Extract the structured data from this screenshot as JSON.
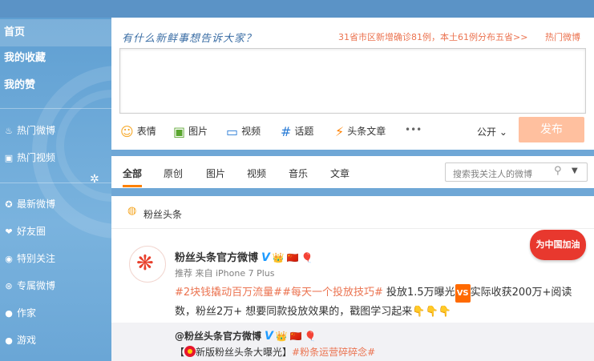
{
  "sidebar": {
    "main": [
      {
        "label": "首页"
      },
      {
        "label": "我的收藏"
      },
      {
        "label": "我的赞"
      }
    ],
    "groups": [
      {
        "label": "热门微博",
        "icon": "flame-icon"
      },
      {
        "label": "热门视频",
        "icon": "video-icon"
      },
      {
        "label": "最新微博",
        "icon": "star-icon"
      },
      {
        "label": "好友圈",
        "icon": "heart-icon"
      },
      {
        "label": "特别关注",
        "icon": "eye-icon"
      },
      {
        "label": "专属微博",
        "icon": "tag-icon"
      },
      {
        "label": "作家",
        "icon": "dot-icon"
      },
      {
        "label": "游戏",
        "icon": "dot-icon"
      }
    ]
  },
  "composer": {
    "prompt": "有什么新鲜事想告诉大家？",
    "trend": "31省市区新增确诊81例，本土61例分布五省>>",
    "trend_right": "热门微博",
    "tools": [
      {
        "label": "表情",
        "icon": "smile-icon",
        "glyph": "☺"
      },
      {
        "label": "图片",
        "icon": "image-icon",
        "glyph": "▣"
      },
      {
        "label": "视频",
        "icon": "video-icon",
        "glyph": "▭"
      },
      {
        "label": "话题",
        "icon": "hash-icon",
        "glyph": "#"
      },
      {
        "label": "头条文章",
        "icon": "bolt-icon",
        "glyph": "⚡"
      }
    ],
    "more": "•••",
    "visibility": "公开",
    "publish": "发布"
  },
  "tabs": {
    "items": [
      "全部",
      "原创",
      "图片",
      "视频",
      "音乐",
      "文章"
    ],
    "search_placeholder": "搜索我关注人的微博"
  },
  "feed": {
    "header": "粉丝头条",
    "post": {
      "author": "粉丝头条官方微博",
      "source": "推荐 来自 iPhone 7 Plus",
      "tag1": "#2块钱撬动百万流量#",
      "tag2": "#每天一个投放技巧#",
      "text1": "投放1.5万曝光",
      "vs": "VS",
      "text2": "实际收获200万+阅读数，粉丝2万+ 想要同款投放效果的，戳图学习起来",
      "hands": "👇👇👇",
      "badge": "为中国加油"
    },
    "repost": {
      "author": "@粉丝头条官方微博",
      "body_prefix": "【",
      "body_text": "新版粉丝头条大曝光】",
      "body_tag": "#粉条运营碎碎念#"
    }
  },
  "colors": {
    "accent": "#ff8200",
    "link": "#eb7350",
    "verified": "#1e9bff",
    "sidebar": "#6fa7d6"
  }
}
